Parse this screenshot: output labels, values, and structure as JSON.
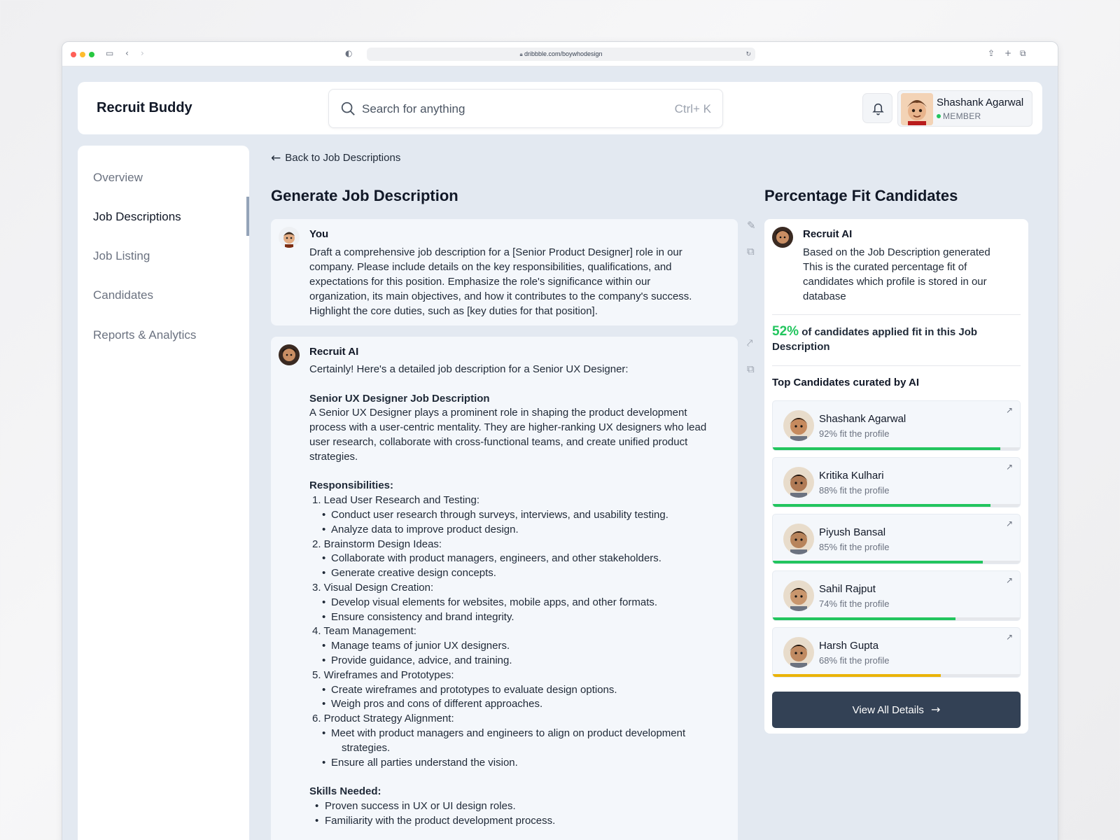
{
  "browser": {
    "url": "dribbble.com/boywhodesign",
    "dot_colors": [
      "#ff5f57",
      "#febc2e",
      "#28c840"
    ]
  },
  "header": {
    "brand": "Recruit Buddy",
    "search_placeholder": "Search for anything",
    "search_shortcut": "Ctrl+ K",
    "user": {
      "name": "Shashank Agarwal",
      "role": "MEMBER"
    }
  },
  "sidebar": {
    "items": [
      {
        "label": "Overview",
        "active": false
      },
      {
        "label": "Job Descriptions",
        "active": true
      },
      {
        "label": "Job Listing",
        "active": false
      },
      {
        "label": "Candidates",
        "active": false
      },
      {
        "label": "Reports & Analytics",
        "active": false
      }
    ]
  },
  "main": {
    "back_label": "Back to Job Descriptions",
    "title": "Generate Job Description",
    "user_message": {
      "author": "You",
      "lines": [
        "Draft a comprehensive job description for a [Senior Product Designer] role in our",
        "company. Please include details on the key responsibilities, qualifications, and",
        "expectations for this position. Emphasize the role's significance within our",
        "organization, its main objectives, and how it contributes to the company's success.",
        "Highlight the core duties, such as [key duties for that position]."
      ]
    },
    "ai_message": {
      "author": "Recruit AI",
      "intro": "Certainly! Here's a detailed job description for a Senior UX Designer:",
      "section_title": "Senior UX Designer Job Description",
      "summary_lines": [
        "A Senior UX Designer plays a prominent role in shaping the product development",
        "process with a user-centric mentality. They are higher-ranking UX designers who lead",
        "user research, collaborate with cross-functional teams, and create unified product",
        "strategies."
      ],
      "responsibilities_title": "Responsibilities:",
      "responsibilities": [
        {
          "title": "1. Lead User Research and Testing:",
          "items": [
            "Conduct user research through surveys, interviews, and usability testing.",
            "Analyze data to improve product design."
          ]
        },
        {
          "title": "2. Brainstorm Design Ideas:",
          "items": [
            "Collaborate with product managers, engineers, and other stakeholders.",
            "Generate creative design concepts."
          ]
        },
        {
          "title": "3. Visual Design Creation:",
          "items": [
            "Develop visual elements for websites, mobile apps, and other formats.",
            "Ensure consistency and brand integrity."
          ]
        },
        {
          "title": "4. Team Management:",
          "items": [
            "Manage teams of junior UX designers.",
            "Provide guidance, advice, and training."
          ]
        },
        {
          "title": "5. Wireframes and Prototypes:",
          "items": [
            "Create wireframes and prototypes to evaluate design options.",
            "Weigh pros and cons of different approaches."
          ]
        },
        {
          "title": "6. Product Strategy Alignment:",
          "items": [
            "Meet with product managers and engineers to align on product development",
            "strategies.",
            "Ensure all parties understand the vision."
          ]
        }
      ],
      "skills_title": "Skills Needed:",
      "skills": [
        "Proven success in UX or UI design roles.",
        "Familiarity with the product development process."
      ]
    }
  },
  "right": {
    "title": "Percentage Fit Candidates",
    "author": "Recruit AI",
    "description_lines": [
      "Based on the Job Description generated",
      "This is the curated percentage fit of",
      "candidates which profile is stored in our",
      "database"
    ],
    "fit_percent": "52%",
    "fit_text": " of candidates applied fit in this Job Description",
    "top_title": "Top Candidates curated by AI",
    "candidates": [
      {
        "name": "Shashank Agarwal",
        "fit": "92% fit the profile",
        "value": 92,
        "color": "#22c55e",
        "skin": "#c68a5e",
        "hair": "#2b1d14"
      },
      {
        "name": "Kritika Kulhari",
        "fit": "88% fit the profile",
        "value": 88,
        "color": "#22c55e",
        "skin": "#b07a55",
        "hair": "#1a120d"
      },
      {
        "name": "Piyush Bansal",
        "fit": "85% fit the profile",
        "value": 85,
        "color": "#22c55e",
        "skin": "#b8845b",
        "hair": "#24180f"
      },
      {
        "name": "Sahil Rajput",
        "fit": "74% fit the profile",
        "value": 74,
        "color": "#22c55e",
        "skin": "#c9966d",
        "hair": "#1e150f"
      },
      {
        "name": "Harsh Gupta",
        "fit": "68% fit the profile",
        "value": 68,
        "color": "#eab308",
        "skin": "#c08a62",
        "hair": "#1b130e"
      }
    ],
    "view_button": "View All Details"
  }
}
